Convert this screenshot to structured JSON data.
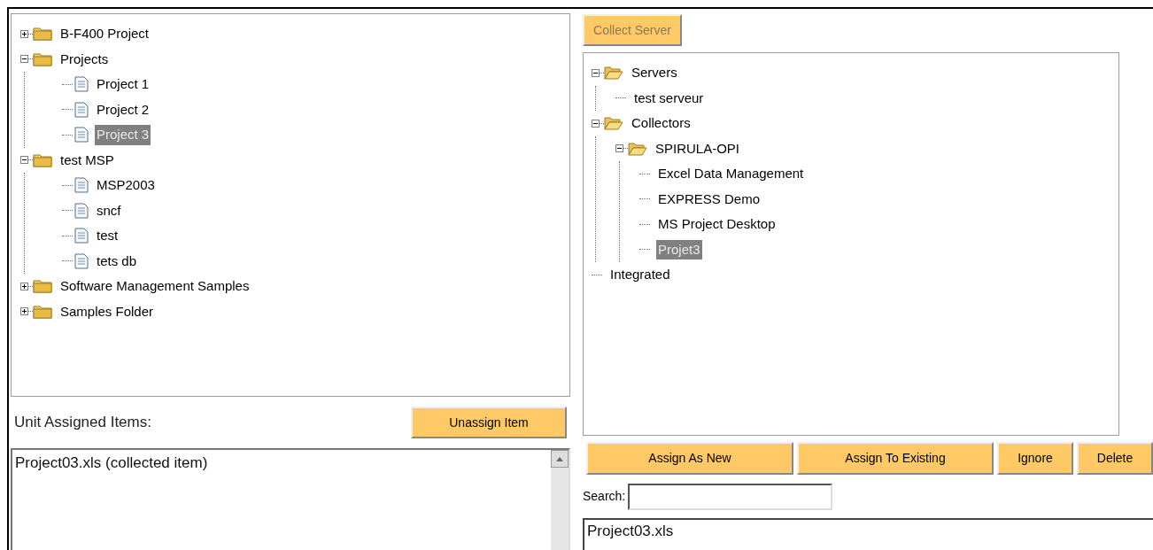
{
  "unit_tree": [
    {
      "label": "B-F400 Project",
      "kind": "folder",
      "expanded": false,
      "selected": false
    },
    {
      "label": "Projects",
      "kind": "folder",
      "expanded": true,
      "selected": false,
      "children": [
        {
          "label": "Project 1",
          "kind": "document",
          "selected": false
        },
        {
          "label": "Project 2",
          "kind": "document",
          "selected": false
        },
        {
          "label": "Project 3",
          "kind": "document",
          "selected": true
        }
      ]
    },
    {
      "label": "test MSP",
      "kind": "folder",
      "expanded": true,
      "selected": false,
      "children": [
        {
          "label": "MSP2003",
          "kind": "document",
          "selected": false
        },
        {
          "label": "sncf",
          "kind": "document",
          "selected": false
        },
        {
          "label": "test",
          "kind": "document",
          "selected": false
        },
        {
          "label": "tets db",
          "kind": "document",
          "selected": false
        }
      ]
    },
    {
      "label": "Software Management Samples",
      "kind": "folder",
      "expanded": false,
      "selected": false
    },
    {
      "label": "Samples Folder",
      "kind": "folder",
      "expanded": false,
      "selected": false
    }
  ],
  "assigned_label": "Unit Assigned Items:",
  "unassign_button": "Unassign Item",
  "assigned_items": [
    "Project03.xls (collected item)"
  ],
  "collect_button": {
    "label": "Collect Server",
    "disabled": true
  },
  "server_tree": [
    {
      "label": "Servers",
      "kind": "folder",
      "expanded": true,
      "selected": false,
      "children": [
        {
          "label": "test serveur",
          "kind": "item",
          "selected": false
        }
      ]
    },
    {
      "label": "Collectors",
      "kind": "folder",
      "expanded": true,
      "selected": false,
      "children": [
        {
          "label": "SPIRULA-OPI",
          "kind": "folder",
          "expanded": true,
          "selected": false,
          "children": [
            {
              "label": "Excel Data Management",
              "kind": "item",
              "selected": false
            },
            {
              "label": "EXPRESS Demo",
              "kind": "item",
              "selected": false
            },
            {
              "label": "MS Project Desktop",
              "kind": "item",
              "selected": false
            },
            {
              "label": "Projet3",
              "kind": "item",
              "selected": true
            }
          ]
        }
      ]
    },
    {
      "label": "Integrated",
      "kind": "item",
      "selected": false
    }
  ],
  "action_buttons": [
    "Assign As New",
    "Assign To Existing",
    "Ignore",
    "Delete"
  ],
  "search": {
    "label": "Search:"
  },
  "results": [
    "Project03.xls"
  ]
}
